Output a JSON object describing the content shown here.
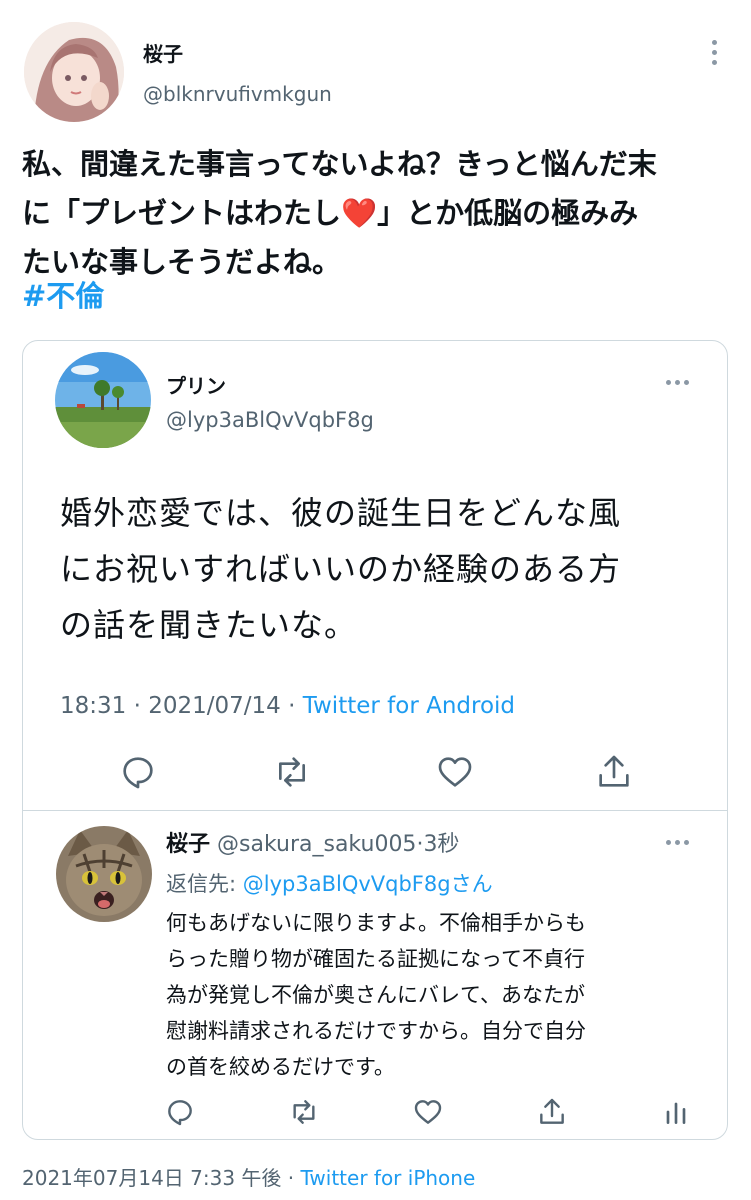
{
  "main_tweet": {
    "name": "桜子",
    "handle": "@blknrvufivmkgun",
    "text_line1": "私、間違えた事言ってないよね？きっと悩んだ末",
    "text_line2_a": "に「プレゼントはわたし",
    "text_line2_emoji": "❤️",
    "text_line2_b": "」とか低脳の極みみ",
    "text_line3": "たいな事しそうだよね。",
    "hashtag": "#不倫"
  },
  "quoted_tweet": {
    "name": "プリン",
    "handle": "@lyp3aBlQvVqbF8g",
    "text_line1": "婚外恋愛では、彼の誕生日をどんな風",
    "text_line2": "にお祝いすればいいのか経験のある方",
    "text_line3": "の話を聞きたいな。",
    "time": "18:31",
    "date": "2021/07/14",
    "sep": " · ",
    "via": "Twitter for Android"
  },
  "reply": {
    "name": "桜子",
    "handle": "@sakura_saku005",
    "time": "3秒",
    "reply_prefix": "返信先: ",
    "reply_mention": "@lyp3aBlQvVqbF8gさん",
    "text_line1": "何もあげないに限りますよ。不倫相手からも",
    "text_line2": "らった贈り物が確固たる証拠になって不貞行",
    "text_line3": "為が発覚し不倫が奥さんにバレて、あなたが",
    "text_line4": "慰謝料請求されるだけですから。自分で自分",
    "text_line5": "の首を絞めるだけです。"
  },
  "footer": {
    "timestamp": "2021年07月14日 7:33 午後",
    "sep": " · ",
    "via": "Twitter for iPhone"
  },
  "colors": {
    "accent": "#1d9bf0",
    "muted": "#536471",
    "border": "#cfd9de"
  }
}
